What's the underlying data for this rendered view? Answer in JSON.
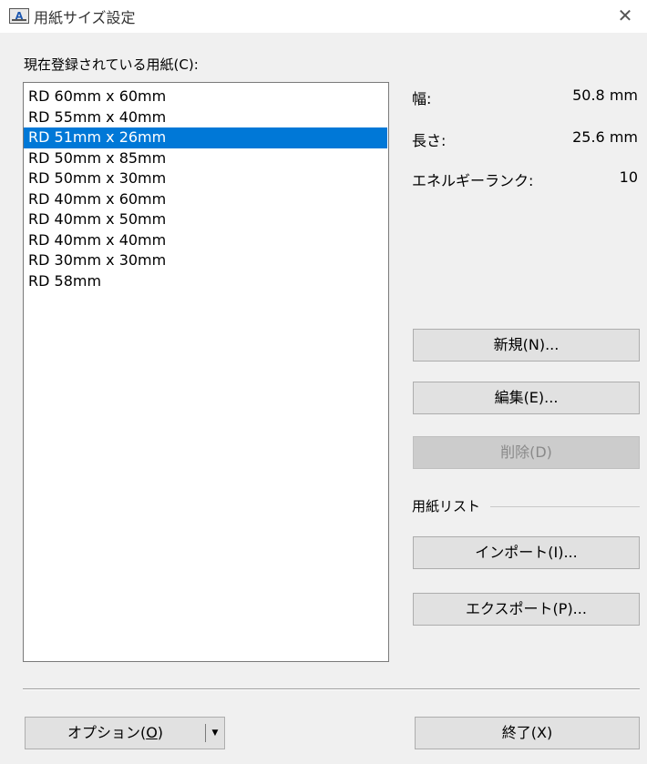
{
  "window": {
    "title": "用紙サイズ設定",
    "app_icon_text": "A",
    "close_glyph": "✕"
  },
  "paper_list": {
    "caption": "現在登録されている用紙(C):",
    "items": [
      "RD 60mm x 60mm",
      "RD 55mm x 40mm",
      "RD 51mm x 26mm",
      "RD 50mm x 85mm",
      "RD 50mm x 30mm",
      "RD 40mm x 60mm",
      "RD 40mm x 50mm",
      "RD 40mm x 40mm",
      "RD 30mm x 30mm",
      "RD 58mm"
    ],
    "selected_item": "RD 51mm x 26mm"
  },
  "properties": {
    "width_label": "幅:",
    "width_value": "50.8 mm",
    "length_label": "長さ:",
    "length_value": "25.6 mm",
    "energy_label": "エネルギーランク:",
    "energy_value": "10"
  },
  "buttons": {
    "new": "新規(N)...",
    "edit": "編集(E)...",
    "delete": "削除(D)",
    "import": "インポート(I)...",
    "export": "エクスポート(P)...",
    "options_prefix": "オプション(",
    "options_key": "O",
    "options_suffix": ")",
    "options_arrow": "▼",
    "close": "終了(X)"
  },
  "group": {
    "paper_list_label": "用紙リスト"
  },
  "colors": {
    "selection_bg": "#0078d7",
    "selection_text": "#ffffff",
    "button_bg": "#e1e1e1",
    "disabled_button_bg": "#cccccc",
    "dialog_bg": "#f0f0f0"
  }
}
